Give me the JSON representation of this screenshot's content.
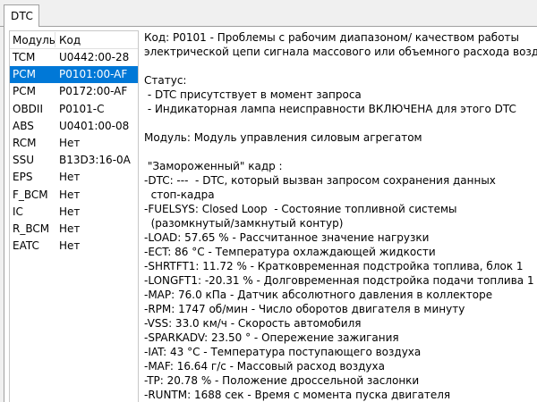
{
  "tab": {
    "label": "DTC"
  },
  "list": {
    "headers": {
      "module": "Модуль",
      "code": "Код"
    },
    "rows": [
      {
        "module": "TCM",
        "code": "U0442:00-28",
        "selected": false
      },
      {
        "module": "PCM",
        "code": "P0101:00-AF",
        "selected": true
      },
      {
        "module": "PCM",
        "code": "P0172:00-AF",
        "selected": false
      },
      {
        "module": "OBDII",
        "code": "P0101-C",
        "selected": false
      },
      {
        "module": "ABS",
        "code": "U0401:00-08",
        "selected": false
      },
      {
        "module": "RCM",
        "code": "Нет",
        "selected": false
      },
      {
        "module": "SSU",
        "code": "B13D3:16-0A",
        "selected": false
      },
      {
        "module": "EPS",
        "code": "Нет",
        "selected": false
      },
      {
        "module": "F_BCM",
        "code": "Нет",
        "selected": false
      },
      {
        "module": "IC",
        "code": "Нет",
        "selected": false
      },
      {
        "module": "R_BCM",
        "code": "Нет",
        "selected": false
      },
      {
        "module": "EATC",
        "code": "Нет",
        "selected": false
      }
    ]
  },
  "detail": {
    "lines": [
      "Код: P0101 - Проблемы с рабочим диапазоном/ качеством работы",
      "электрической цепи сигнала массового или объемного расхода воздуха",
      "",
      "Статус:",
      " - DTC присутствует в момент запроса",
      " - Индикаторная лампа неисправности ВКЛЮЧЕНА для этого DTC",
      "",
      "Модуль: Модуль управления силовым агрегатом",
      "",
      " \"Замороженный\" кадр :",
      "-DTC: ---  - DTC, который вызван запросом сохранения данных",
      "  стоп-кадра",
      "-FUELSYS: Closed Loop  - Состояние топливной системы",
      "  (разомкнутый/замкнутый контур)",
      "-LOAD: 57.65 % - Рассчитанное значение нагрузки",
      "-ECT: 86 °C - Температура охлаждающей жидкости",
      "-SHRTFT1: 11.72 % - Кратковременная подстройка топлива, блок 1",
      "-LONGFT1: -20.31 % - Долговременная подстройка подачи топлива 1",
      "-MAP: 76.0 кПа - Датчик абсолютного давления в коллекторе",
      "-RPM: 1747 об/мин - Число оборотов двигателя в минуту",
      "-VSS: 33.0 км/ч - Скорость автомобиля",
      "-SPARKADV: 23.50 ° - Опережение зажигания",
      "-IAT: 43 °C - Температура поступающего воздуха",
      "-MAF: 16.64 г/с - Массовый расход воздуха",
      "-TP: 20.78 % - Положение дроссельной заслонки",
      "-RUNTM: 1688 сек - Время с момента пуска двигателя"
    ]
  },
  "colors": {
    "selection": "#0078d7",
    "border": "#a0a0a0",
    "background": "#f0f0f0"
  }
}
